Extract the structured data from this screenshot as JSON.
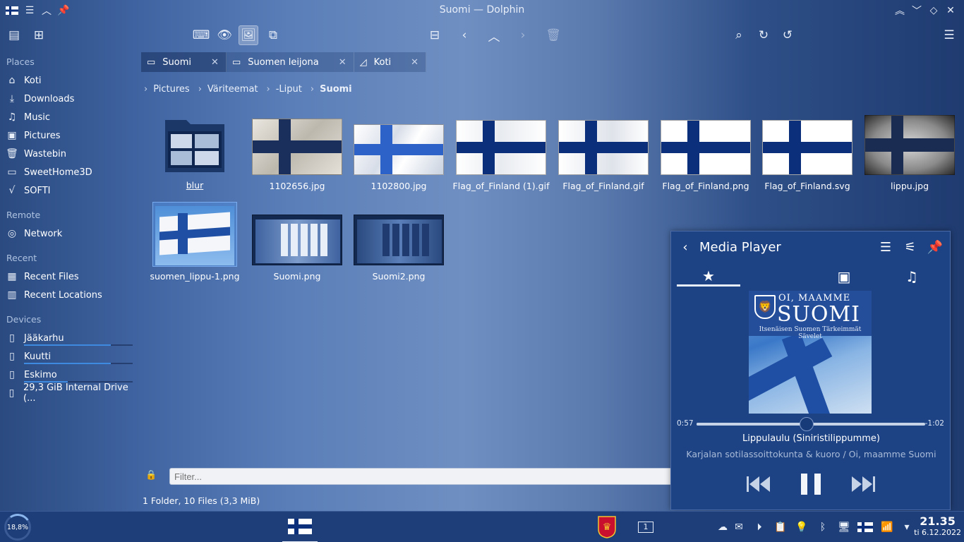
{
  "window": {
    "title": "Suomi — Dolphin"
  },
  "sidebar": {
    "sections": {
      "places": "Places",
      "remote": "Remote",
      "recent": "Recent",
      "devices": "Devices"
    },
    "places": [
      {
        "label": "Koti",
        "icon": "home-icon"
      },
      {
        "label": "Downloads",
        "icon": "download-icon"
      },
      {
        "label": "Music",
        "icon": "music-icon"
      },
      {
        "label": "Pictures",
        "icon": "pictures-icon"
      },
      {
        "label": "Wastebin",
        "icon": "trash-icon"
      },
      {
        "label": "SweetHome3D",
        "icon": "folder-icon"
      },
      {
        "label": "SOFTI",
        "icon": "formula-icon"
      }
    ],
    "remote": [
      {
        "label": "Network",
        "icon": "network-icon"
      }
    ],
    "recent": [
      {
        "label": "Recent Files",
        "icon": "recent-files-icon"
      },
      {
        "label": "Recent Locations",
        "icon": "recent-locations-icon"
      }
    ],
    "devices": [
      {
        "label": "Jääkarhu",
        "usage": 0.8
      },
      {
        "label": "Kuutti",
        "usage": 0.8
      },
      {
        "label": "Eskimo",
        "usage": 0.4
      },
      {
        "label": "29,3 GiB Internal Drive (..."
      }
    ]
  },
  "tabs": [
    {
      "label": "Suomi",
      "active": true
    },
    {
      "label": "Suomen leijona",
      "active": false
    },
    {
      "label": "Koti",
      "active": false
    }
  ],
  "breadcrumb": [
    "Pictures",
    "Väriteemat",
    "-Liput",
    "Suomi"
  ],
  "files": [
    {
      "name": "blur",
      "type": "folder"
    },
    {
      "name": "1102656.jpg"
    },
    {
      "name": "1102800.jpg"
    },
    {
      "name": "Flag_of_Finland (1).gif"
    },
    {
      "name": "Flag_of_Finland.gif"
    },
    {
      "name": "Flag_of_Finland.png"
    },
    {
      "name": "Flag_of_Finland.svg"
    },
    {
      "name": "lippu.jpg"
    },
    {
      "name": "suomen_lippu-1.png",
      "selected": true
    },
    {
      "name": "Suomi.png"
    },
    {
      "name": "Suomi2.png"
    }
  ],
  "filter": {
    "placeholder": "Filter..."
  },
  "status": {
    "text": "1 Folder, 10 Files (3,3 MiB)"
  },
  "media_player": {
    "title": "Media Player",
    "album": {
      "line1": "OI, MAAMME",
      "line2": "SUOMI",
      "line3": "Itsenäisen Suomen Tärkeimmät Sävelet"
    },
    "elapsed": "0:57",
    "remaining": "-1:02",
    "progress": 0.48,
    "track": "Lippulaulu (Siniristilippumme)",
    "artist_album": "Karjalan sotilassoittokunta & kuoro / Oi, maamme Suomi"
  },
  "taskbar": {
    "cpu": "18,8%",
    "desktop_number": "1",
    "time": "21.35",
    "date": "ti 6.12.2022"
  },
  "colors": {
    "accent": "#3d8ae0",
    "panel": "#1d4384",
    "flag_blue": "#0b2f7a"
  }
}
